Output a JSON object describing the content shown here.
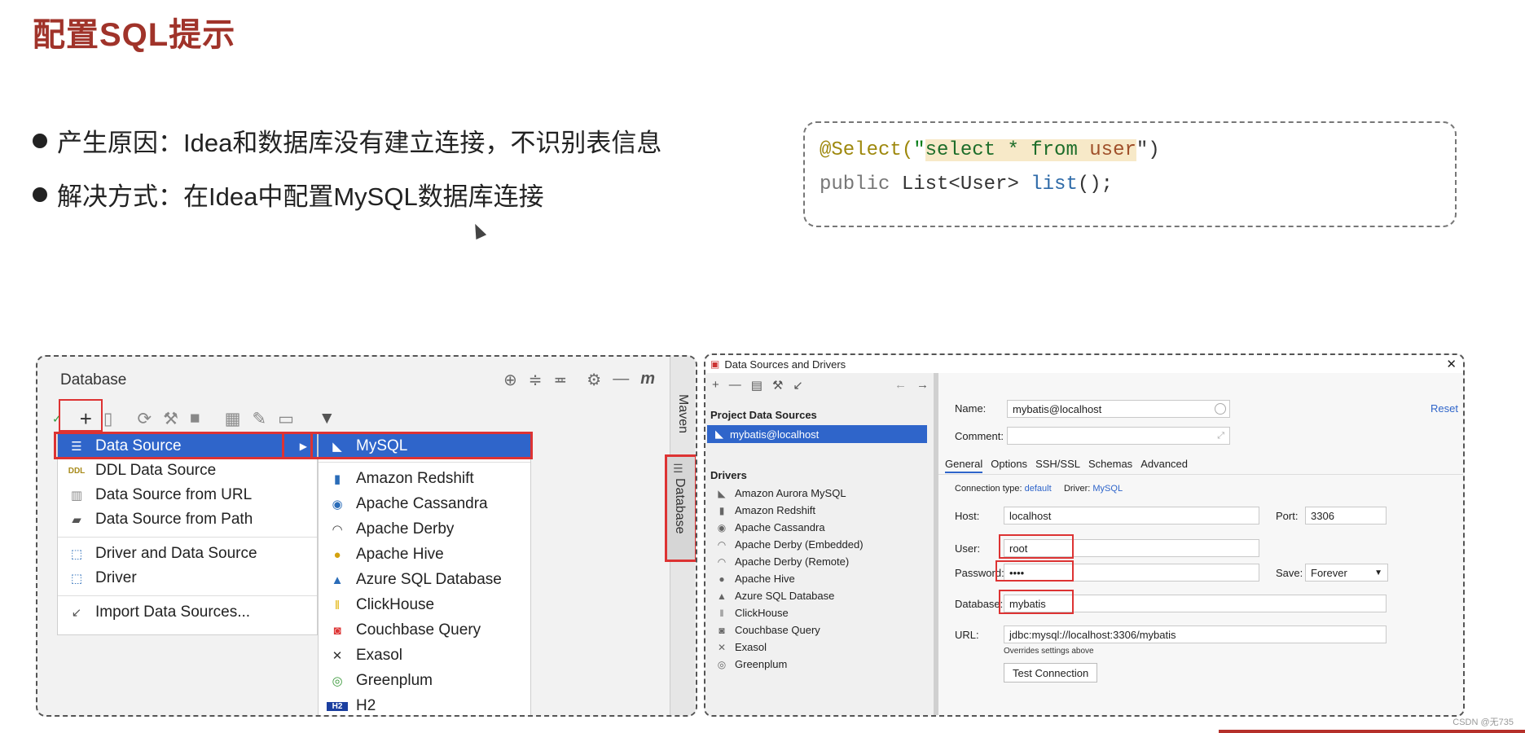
{
  "slide": {
    "title": "配置SQL提示",
    "bullets": [
      "产生原因：Idea和数据库没有建立连接，不识别表信息",
      "解决方式：在Idea中配置MySQL数据库连接"
    ]
  },
  "code": {
    "line1_annotation": "@Select(",
    "line1_quote_open": "\"",
    "line1_sql_kw": "select * from",
    "line1_sql_tbl": " user",
    "line1_close": "\")",
    "line2_kw": "public",
    "line2_type": " List<User> ",
    "line2_fn": "list",
    "line2_tail": "();"
  },
  "database_panel": {
    "title": "Database",
    "side_tabs": [
      "Maven",
      "Database"
    ],
    "add_menu": [
      {
        "label": "Data Source",
        "icon": "data-source-icon",
        "selected": true
      },
      {
        "label": "DDL Data Source",
        "icon": "ddl-icon"
      },
      {
        "label": "Data Source from URL",
        "icon": "url-icon"
      },
      {
        "label": "Data Source from Path",
        "icon": "folder-icon"
      },
      {
        "label": "Driver and Data Source",
        "icon": "driver-icon"
      },
      {
        "label": "Driver",
        "icon": "driver-icon"
      },
      {
        "label": "Import Data Sources...",
        "icon": "import-icon"
      }
    ],
    "submenu": [
      "MySQL",
      "Amazon Redshift",
      "Apache Cassandra",
      "Apache Derby",
      "Apache Hive",
      "Azure SQL Database",
      "ClickHouse",
      "Couchbase Query",
      "Exasol",
      "Greenplum",
      "H2"
    ]
  },
  "dialog": {
    "title": "Data Sources and Drivers",
    "project_sources_header": "Project Data Sources",
    "selected_source": "mybatis@localhost",
    "drivers_header": "Drivers",
    "drivers": [
      "Amazon Aurora MySQL",
      "Amazon Redshift",
      "Apache Cassandra",
      "Apache Derby (Embedded)",
      "Apache Derby (Remote)",
      "Apache Hive",
      "Azure SQL Database",
      "ClickHouse",
      "Couchbase Query",
      "Exasol",
      "Greenplum"
    ],
    "name_label": "Name:",
    "name_value": "mybatis@localhost",
    "comment_label": "Comment:",
    "reset": "Reset",
    "tabs": [
      "General",
      "Options",
      "SSH/SSL",
      "Schemas",
      "Advanced"
    ],
    "conn_type_label": "Connection type:",
    "conn_type_value": "default",
    "driver_label": "Driver:",
    "driver_value": "MySQL",
    "host_label": "Host:",
    "host_value": "localhost",
    "port_label": "Port:",
    "port_value": "3306",
    "user_label": "User:",
    "user_value": "root",
    "password_label": "Password:",
    "password_value": "••••",
    "save_label": "Save:",
    "save_value": "Forever",
    "database_label": "Database:",
    "database_value": "mybatis",
    "url_label": "URL:",
    "url_value": "jdbc:mysql://localhost:3306/mybatis",
    "url_note": "Overrides settings above",
    "test_button": "Test Connection"
  },
  "watermark": "CSDN @无735",
  "colors": {
    "title": "#a0332a",
    "selection": "#2f65ca",
    "highlight_box": "#dd3333"
  }
}
